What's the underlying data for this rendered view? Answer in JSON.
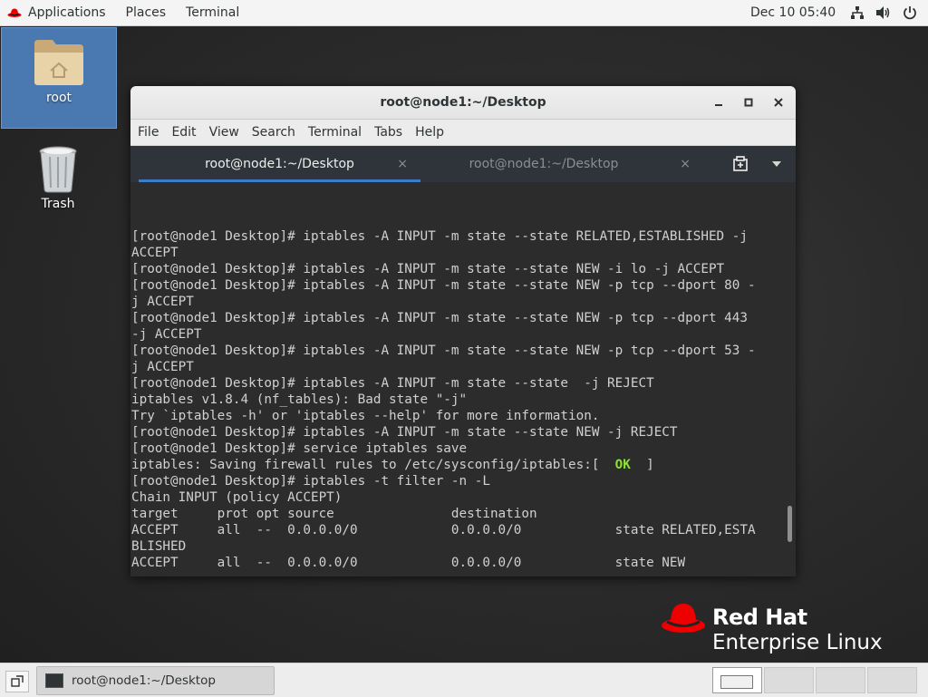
{
  "top_panel": {
    "applications": "Applications",
    "places": "Places",
    "terminal": "Terminal",
    "clock": "Dec 10  05:40",
    "icons": [
      "network-icon",
      "volume-icon",
      "power-icon"
    ]
  },
  "desktop": {
    "icons": [
      {
        "label": "root",
        "icon": "home-folder-icon"
      },
      {
        "label": "Trash",
        "icon": "trash-icon"
      }
    ]
  },
  "window": {
    "title": "root@node1:~/Desktop",
    "menu": [
      "File",
      "Edit",
      "View",
      "Search",
      "Terminal",
      "Tabs",
      "Help"
    ],
    "tabs": [
      {
        "label": "root@node1:~/Desktop",
        "active": true
      },
      {
        "label": "root@node1:~/Desktop",
        "active": false
      }
    ],
    "close_glyph": "×",
    "terminal_lines": [
      "[root@node1 Desktop]# iptables -A INPUT -m state --state RELATED,ESTABLISHED -j",
      "ACCEPT",
      "[root@node1 Desktop]# iptables -A INPUT -m state --state NEW -i lo -j ACCEPT",
      "[root@node1 Desktop]# iptables -A INPUT -m state --state NEW -p tcp --dport 80 -",
      "j ACCEPT",
      "[root@node1 Desktop]# iptables -A INPUT -m state --state NEW -p tcp --dport 443",
      "-j ACCEPT",
      "[root@node1 Desktop]# iptables -A INPUT -m state --state NEW -p tcp --dport 53 -",
      "j ACCEPT",
      "[root@node1 Desktop]# iptables -A INPUT -m state --state  -j REJECT",
      "iptables v1.8.4 (nf_tables): Bad state \"-j\"",
      "Try `iptables -h' or 'iptables --help' for more information.",
      "[root@node1 Desktop]# iptables -A INPUT -m state --state NEW -j REJECT",
      "[root@node1 Desktop]# service iptables save",
      "iptables: Saving firewall rules to /etc/sysconfig/iptables:[",
      "[root@node1 Desktop]# iptables -t filter -n -L",
      "Chain INPUT (policy ACCEPT)",
      "target     prot opt source               destination",
      "ACCEPT     all  --  0.0.0.0/0            0.0.0.0/0            state RELATED,ESTA",
      "BLISHED",
      "ACCEPT     all  --  0.0.0.0/0            0.0.0.0/0            state NEW"
    ],
    "save_status_ok": "OK",
    "save_status_suffix": "  ]"
  },
  "branding": {
    "line1": "Red Hat",
    "line2": "Enterprise Linux",
    "accent": "#ee0000"
  },
  "bottom_panel": {
    "task_label": "root@node1:~/Desktop",
    "workspaces": 4,
    "active_workspace": 1
  }
}
